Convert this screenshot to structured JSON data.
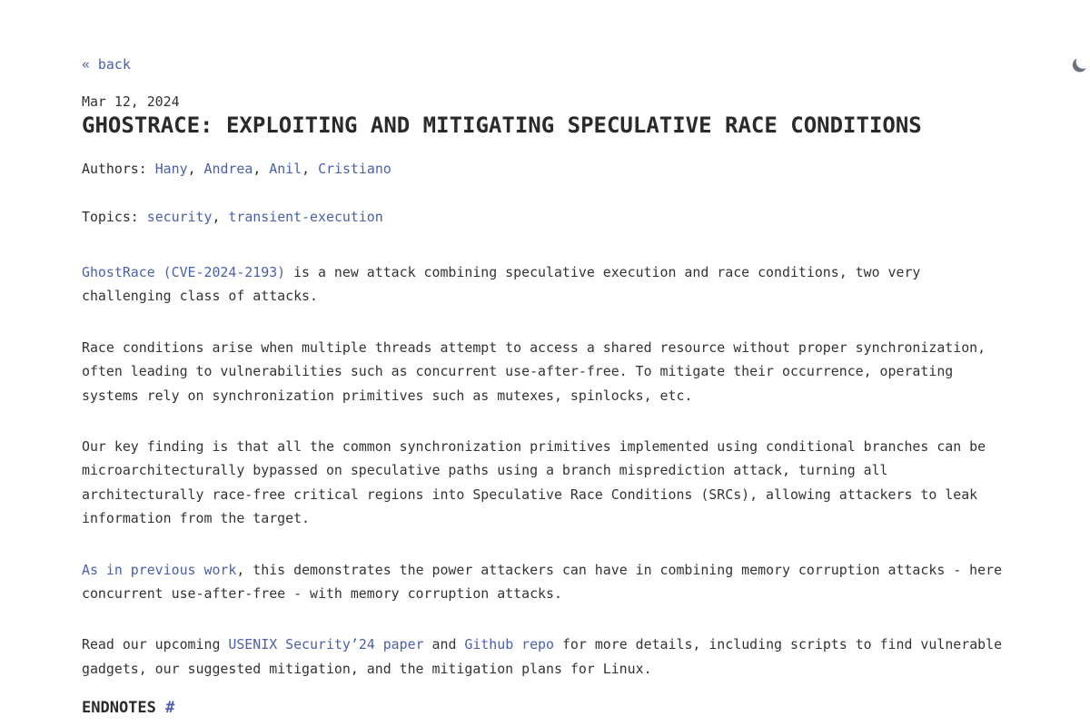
{
  "nav": {
    "back_label": "« back",
    "theme_toggle_icon": "moon-icon"
  },
  "post": {
    "date": "Mar 12, 2024",
    "title": "GHOSTRACE: EXPLOITING AND MITIGATING SPECULATIVE RACE CONDITIONS",
    "authors_label": "Authors:",
    "authors": [
      "Hany",
      "Andrea",
      "Anil",
      "Cristiano"
    ],
    "topics_label": "Topics:",
    "topics": [
      "security",
      "transient-execution"
    ],
    "separator": ", "
  },
  "body": {
    "p1": {
      "link": "GhostRace (CVE-2024-2193)",
      "text": " is a new attack combining speculative execution and race conditions, two very challenging class of attacks."
    },
    "p2": "Race conditions arise when multiple threads attempt to access a shared resource without proper synchronization, often leading to vulnerabilities such as concurrent use-after-free. To mitigate their occurrence, operating systems rely on synchronization primitives such as mutexes, spinlocks, etc.",
    "p3": "Our key finding is that all the common synchronization primitives implemented using conditional branches can be microarchitecturally bypassed on speculative paths using a branch misprediction attack, turning all architecturally race-free critical regions into Speculative Race Conditions (SRCs), allowing attackers to leak information from the target.",
    "p4": {
      "link": "As in previous work",
      "text": ", this demonstrates the power attackers can have in combining memory corruption attacks - here concurrent use-after-free - with memory corruption attacks."
    },
    "p5": {
      "text1": "Read our upcoming ",
      "link1": "USENIX Security’24 paper",
      "text2": " and ",
      "link2": "Github repo",
      "text3": " for more details, including scripts to find vulnerable gadgets, our suggested mitigation, and the mitigation plans for Linux."
    }
  },
  "endnotes": {
    "heading": "ENDNOTES",
    "anchor": "#"
  },
  "colors": {
    "text": "#333333",
    "link": "#4a5fae",
    "icon": "#6b7280",
    "background": "#ffffff"
  }
}
